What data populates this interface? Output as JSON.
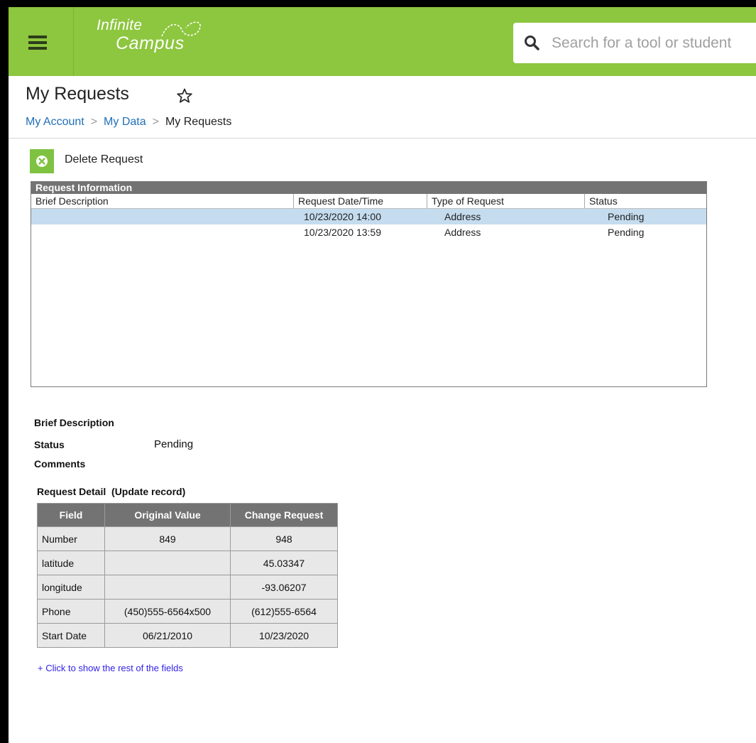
{
  "header": {
    "logo_line1": "Infinite",
    "logo_line2": "Campus",
    "search_placeholder": "Search for a tool or student",
    "icons": {
      "menu": "hamburger-menu-icon",
      "search": "search-icon",
      "logo": "infinity-loop-icon"
    }
  },
  "page": {
    "title": "My Requests",
    "breadcrumb": [
      "My Account",
      "My Data",
      "My Requests"
    ],
    "sep": ">"
  },
  "toolbar": {
    "delete_label": "Delete Request"
  },
  "request_list": {
    "title": "Request Information",
    "columns": [
      "Brief Description",
      "Request Date/Time",
      "Type of Request",
      "Status"
    ],
    "rows": [
      {
        "description": "",
        "datetime": "10/23/2020 14:00",
        "type": "Address",
        "status": "Pending",
        "selected": true
      },
      {
        "description": "",
        "datetime": "10/23/2020 13:59",
        "type": "Address",
        "status": "Pending",
        "selected": false
      }
    ]
  },
  "detail": {
    "brief_description_label": "Brief Description",
    "status_label": "Status",
    "status_value": "Pending",
    "comments_label": "Comments",
    "caption": "Request Detail  (Update record)",
    "table_headers": [
      "Field",
      "Original Value",
      "Change Request"
    ],
    "table_rows": [
      [
        "Number",
        "849",
        "948"
      ],
      [
        "latitude",
        "",
        "45.03347"
      ],
      [
        "longitude",
        "",
        "-93.06207"
      ],
      [
        "Phone",
        "(450)555-6564x500",
        "(612)555-6564"
      ],
      [
        "Start Date",
        "06/21/2010",
        "10/23/2020"
      ]
    ],
    "show_more": "+ Click to show the rest of the fields"
  },
  "colors": {
    "brand_green": "#8dc63f",
    "header_gray": "#737373",
    "selected_row": "#c5dcef",
    "link_blue": "#1f6fb8"
  }
}
